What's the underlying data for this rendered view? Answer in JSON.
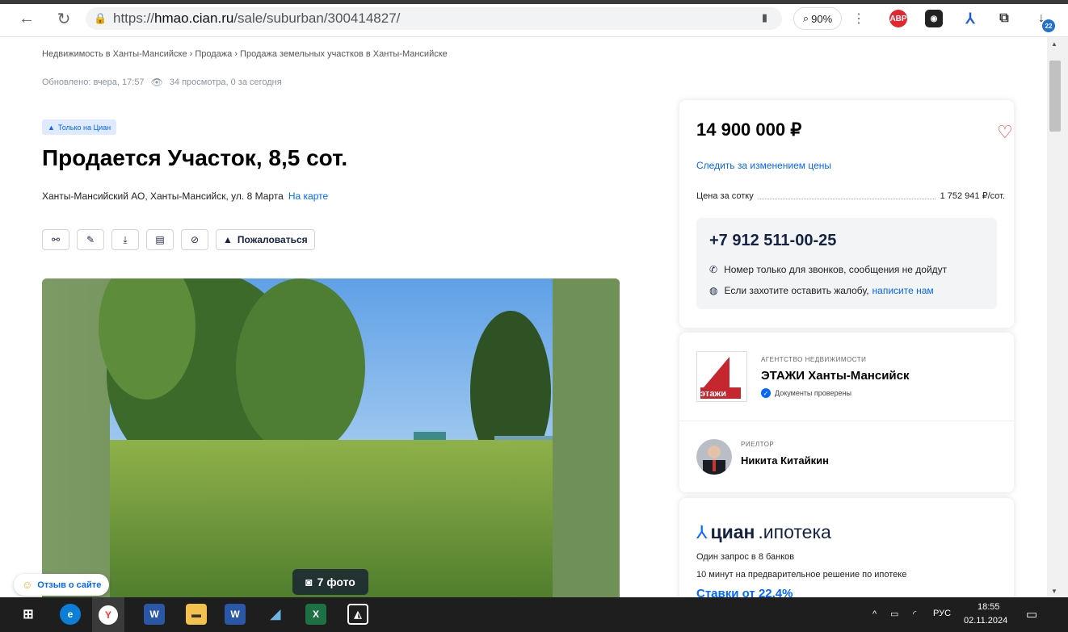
{
  "browser": {
    "url_scheme": "https://",
    "url_host": "hmao.cian.ru",
    "url_path": "/sale/suburban/300414827/",
    "zoom": "90%",
    "download_badge": "22"
  },
  "page": {
    "breadcrumb": "Недвижимость в Ханты-Мансийске  ›  Продажа  ›  Продажа земельных участков в Ханты-Мансийске",
    "updated": "Обновлено: вчера, 17:57",
    "views": "34 просмотра, 0 за сегодня",
    "badge": "Только на Циан",
    "title": "Продается Участок, 8,5 сот.",
    "address": "Ханты-Мансийский АО, Ханты-Мансийск, ул. 8 Марта",
    "map_link": "На карте",
    "complaint": "Пожаловаться",
    "feedback": "Отзыв о сайте",
    "photo_count": "7 фото"
  },
  "offer": {
    "price": "14 900 000 ₽",
    "follow": "Следить за изменением цены",
    "per_hundred_label": "Цена за сотку",
    "per_hundred_value": "1 752 941 ₽/сот.",
    "phone": "+7 912 511-00-25",
    "note_calls": "Номер только для звонков, сообщения не дойдут",
    "note_complaint": "Если захотите оставить жалобу,",
    "note_complaint_link": "написите нам"
  },
  "agency": {
    "caption": "АГЕНТСТВО НЕДВИЖИМОСТИ",
    "name": "ЭТАЖИ Ханты-Мансийск",
    "verified": "Документы проверены",
    "logo_text": "этажи"
  },
  "realtor": {
    "caption": "РИЕЛТОР",
    "name": "Никита Китайкин"
  },
  "ipoteka": {
    "brand": "циан",
    "suffix": ".ипотека",
    "line1": "Один запрос в 8 банков",
    "line2": "10 минут на предварительное решение по ипотеке",
    "rates": "Ставки от 22,4%"
  },
  "taskbar": {
    "lang": "РУС",
    "time": "18:55",
    "date": "02.11.2024"
  }
}
